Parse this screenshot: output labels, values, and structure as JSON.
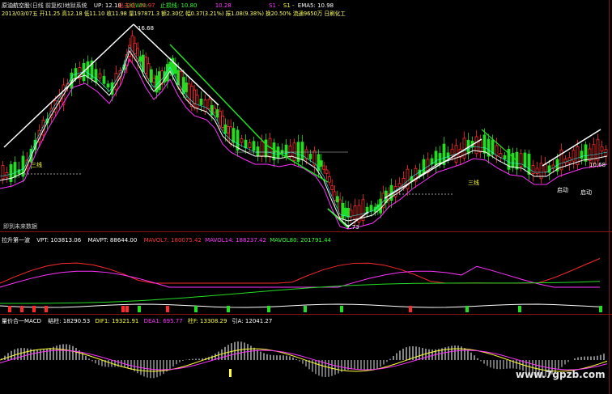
{
  "colors": {
    "bg": "#000000",
    "up": "#ff2a2a",
    "down": "#22dd22",
    "white": "#ffffff",
    "yellow": "#ffff33",
    "magenta": "#ff33ff",
    "cyan": "#33ffff",
    "divider": "#8a1414",
    "label_gray": "#c8c8c8"
  },
  "main_panel": {
    "name_label": "原油航空股",
    "indicator_name": "(日线 前复权)地狱系统",
    "up_label": "UP: 12.18",
    "down_label": "DOWN:-",
    "stop_label": "出击线: 10.97",
    "sell_label": "止损线: 10.80",
    "extra_val": "10.28",
    "ma_s1": "S1 -",
    "ma_s2": "S1 -",
    "ema_label": "EMA5: 10.98",
    "info_line": "2013/03/07五 开11.25 高12.18 低11.10 收11.98 量197871.3 额2.30亿 幅0.37(3.21%) 振1.08(9.38%) 换20.50% 流通9650万 日刷化工",
    "high_price_label": "16.68",
    "low_price_label": "7.73",
    "latest_price_label": "10.68",
    "future_label": "即到未来数据",
    "signal_start_1": "启动",
    "signal_start_2": "启动",
    "signal_sanyi_1": "三线",
    "signal_sanyi_2": "三线"
  },
  "vol_panel": {
    "name_label": "拉升第一波",
    "vpt_label": "VPT: 103813.06",
    "mavpt_label": "MAVPT: 88644.00",
    "mavol7_label": "MAVOL7: 180075.42",
    "mavol14_label": "MAVOL14: 188237.42",
    "mavol80_label": "MAVOL80: 201791.44"
  },
  "macd_panel": {
    "name_label": "量价合一MACD",
    "dif_prefix": "结柱: 18290.53",
    "dif_label": "DIF1: 19321.91",
    "dea_label": "DEA1: 695.77",
    "macd_label": "柱F: 13308.29",
    "extra_label": "引A: 12041.27"
  },
  "watermark": "www.7gpzb.com"
}
